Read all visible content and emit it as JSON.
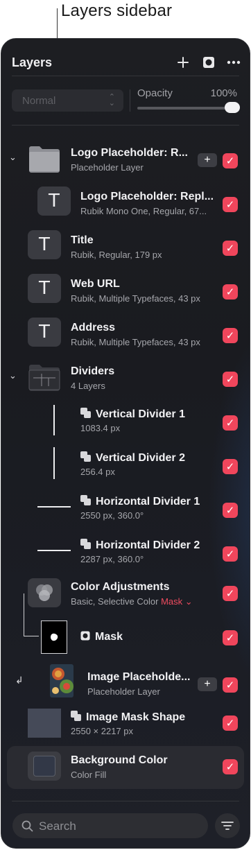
{
  "callout": {
    "label": "Layers sidebar"
  },
  "header": {
    "title": "Layers",
    "add_icon": "plus-icon",
    "mask_icon": "mask-icon",
    "more_icon": "ellipsis-icon"
  },
  "blend": {
    "mode": "Normal",
    "opacity_label": "Opacity",
    "opacity_value": "100%",
    "opacity_fraction": 1.0
  },
  "layers": [
    {
      "name": "Logo Placeholder: R...",
      "sub": "Placeholder Layer",
      "visible": true
    },
    {
      "name": "Logo Placeholder: Repl...",
      "sub": "Rubik Mono One, Regular, 67...",
      "visible": true,
      "thumb": "T"
    },
    {
      "name": "Title",
      "sub": "Rubik, Regular, 179 px",
      "visible": true,
      "thumb": "T"
    },
    {
      "name": "Web URL",
      "sub": "Rubik, Multiple Typefaces, 43 px",
      "visible": true,
      "thumb": "T"
    },
    {
      "name": "Address",
      "sub": "Rubik, Multiple Typefaces, 43 px",
      "visible": true,
      "thumb": "T"
    },
    {
      "name": "Dividers",
      "sub": "4 Layers",
      "visible": true
    },
    {
      "name": "Vertical Divider 1",
      "sub": "1083.4 px",
      "visible": true
    },
    {
      "name": "Vertical Divider 2",
      "sub": "256.4 px",
      "visible": true
    },
    {
      "name": "Horizontal Divider 1",
      "sub": "2550 px, 360.0°",
      "visible": true
    },
    {
      "name": "Horizontal Divider 2",
      "sub": "2287 px, 360.0°",
      "visible": true
    },
    {
      "name": "Color Adjustments",
      "sub": "Basic, Selective Color",
      "mask_link": "Mask",
      "visible": true
    },
    {
      "name": "Mask",
      "visible": true
    },
    {
      "name": "Image Placeholde...",
      "sub": "Placeholder Layer",
      "visible": true
    },
    {
      "name": "Image Mask Shape",
      "sub": "2550 × 2217 px",
      "visible": true
    },
    {
      "name": "Background Color",
      "sub": "Color Fill",
      "visible": true,
      "selected": true
    }
  ],
  "add_button": "+",
  "check_glyph": "✓",
  "search": {
    "placeholder": "Search"
  },
  "colors": {
    "accent": "#f0465c",
    "panel": "#1c1d22",
    "selected_row": "#2a2b31"
  }
}
